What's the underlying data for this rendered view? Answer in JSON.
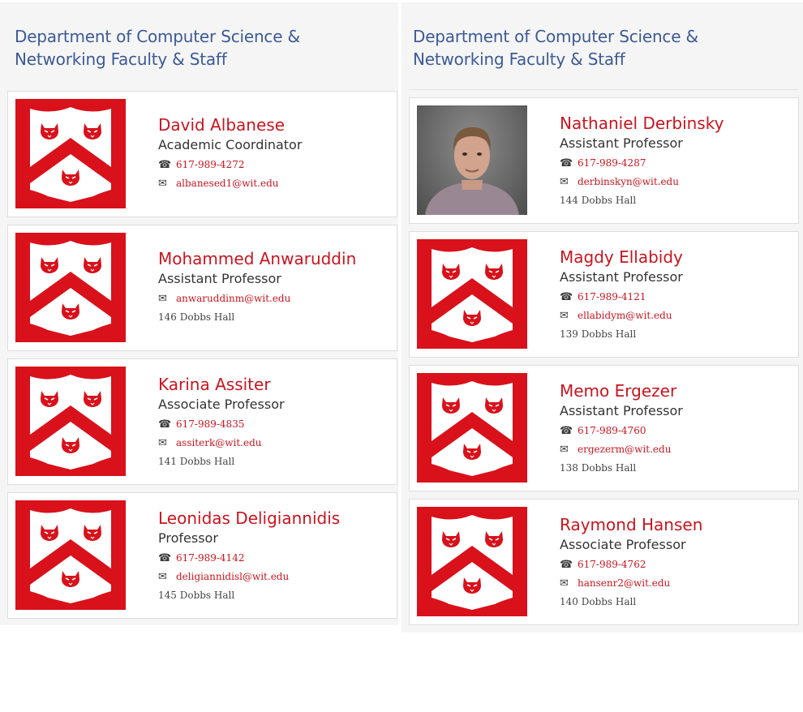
{
  "left": {
    "heading": "Department of Computer Science & Networking Faculty & Staff",
    "people": [
      {
        "name": "David Albanese",
        "title": "Academic Coordinator",
        "phone": "617-989-4272",
        "email": "albanesed1@wit.edu",
        "location": ""
      },
      {
        "name": "Mohammed Anwaruddin",
        "title": "Assistant Professor",
        "phone": "",
        "email": "anwaruddinm@wit.edu",
        "location": "146 Dobbs Hall"
      },
      {
        "name": "Karina Assiter",
        "title": "Associate Professor",
        "phone": "617-989-4835",
        "email": "assiterk@wit.edu",
        "location": "141 Dobbs Hall"
      },
      {
        "name": "Leonidas Deligiannidis",
        "title": "Professor",
        "phone": "617-989-4142",
        "email": "deligiannidisl@wit.edu",
        "location": "145 Dobbs Hall"
      }
    ]
  },
  "right": {
    "heading": "Department of Computer Science & Networking Faculty & Staff",
    "people": [
      {
        "name": "Nathaniel Derbinsky",
        "title": "Assistant Professor",
        "phone": "617-989-4287",
        "email": "derbinskyn@wit.edu",
        "location": "144 Dobbs Hall"
      },
      {
        "name": "Magdy Ellabidy",
        "title": "Assistant Professor",
        "phone": "617-989-4121",
        "email": "ellabidym@wit.edu",
        "location": "139 Dobbs Hall"
      },
      {
        "name": "Memo Ergezer",
        "title": "Assistant Professor",
        "phone": "617-989-4760",
        "email": "ergezerm@wit.edu",
        "location": "138 Dobbs Hall"
      },
      {
        "name": "Raymond Hansen",
        "title": "Associate Professor",
        "phone": "617-989-4762",
        "email": "hansenr2@wit.edu",
        "location": "140 Dobbs Hall"
      }
    ]
  },
  "icons": {
    "phone": "phone-icon",
    "email": "envelope-icon",
    "logo": "wit-crest-logo"
  },
  "colors": {
    "heading": "#3c5a96",
    "accent": "#c8151f",
    "crest": "#d8111b"
  }
}
